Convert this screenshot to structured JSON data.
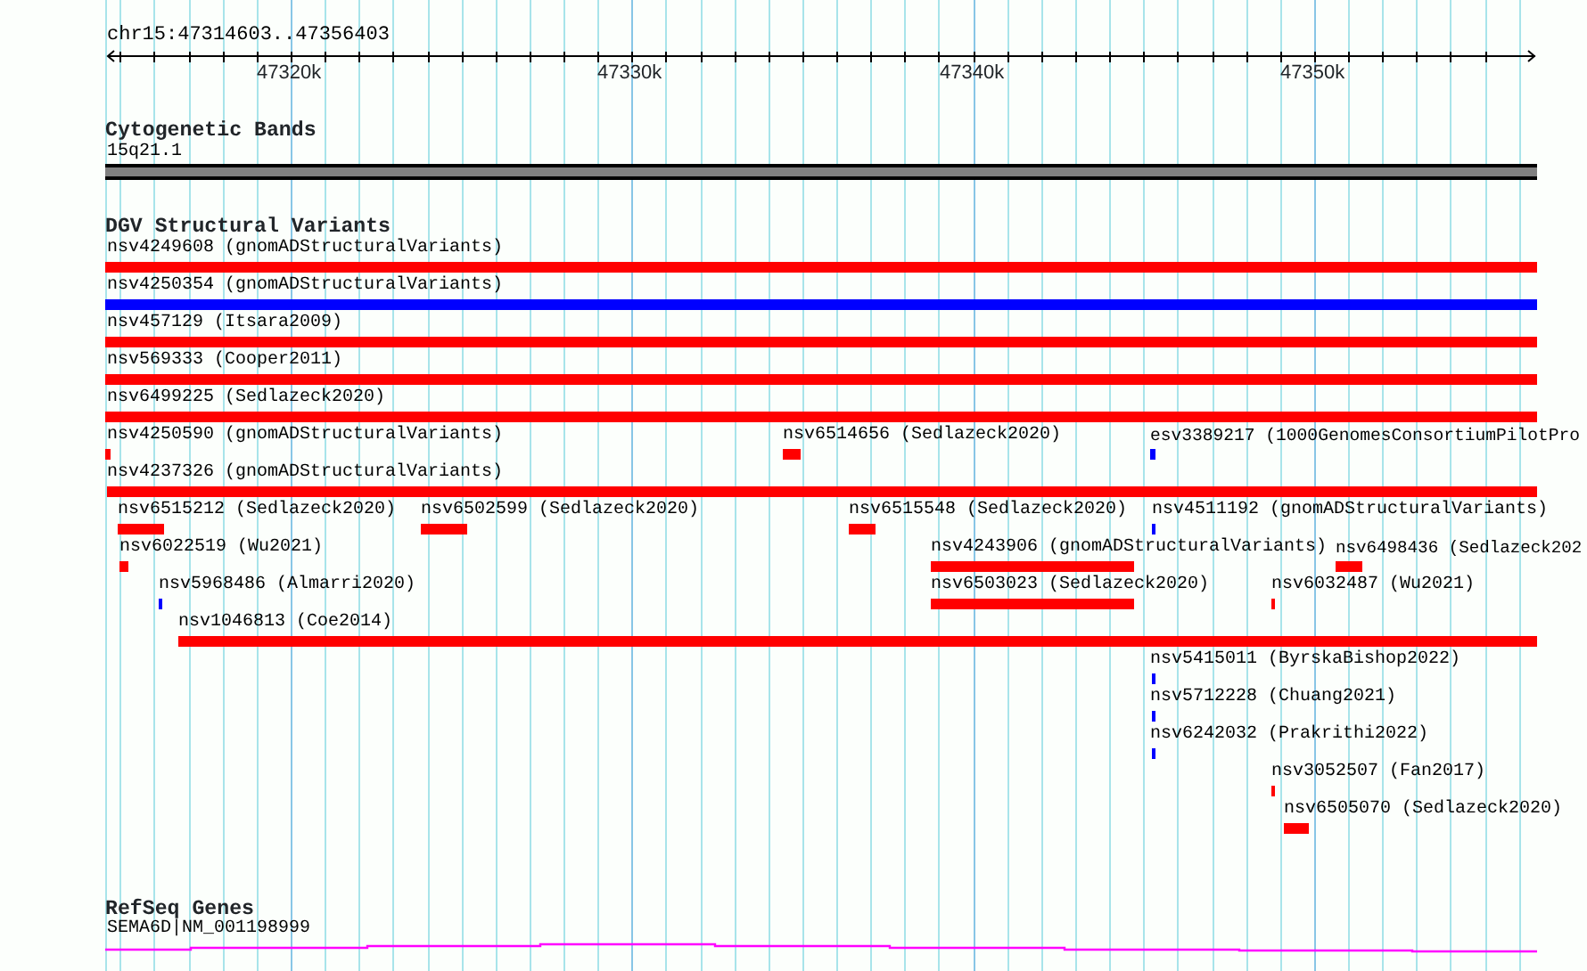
{
  "ruler": {
    "location": "chr15:47314603..47356403",
    "ticks": [
      "47320k",
      "47330k",
      "47340k",
      "47350k"
    ]
  },
  "tracks": [
    {
      "kind": "bands",
      "title": "Cytogenetic Bands",
      "features": [
        {
          "label": "15q21.1"
        }
      ]
    },
    {
      "kind": "variants",
      "title": "DGV Structural Variants",
      "features": [
        {
          "label": "nsv4249608 (gnomADStructuralVariants)",
          "color": "#ff0000"
        },
        {
          "label": "nsv4250354 (gnomADStructuralVariants)",
          "color": "#0000ff"
        },
        {
          "label": "nsv457129 (Itsara2009)",
          "color": "#ff0000"
        },
        {
          "label": "nsv569333 (Cooper2011)",
          "color": "#ff0000"
        },
        {
          "label": "nsv6499225 (Sedlazeck2020)",
          "color": "#ff0000"
        },
        {
          "label": "nsv4250590 (gnomADStructuralVariants)",
          "color": "#ff0000"
        },
        {
          "label": "nsv6514656 (Sedlazeck2020)",
          "color": "#ff0000"
        },
        {
          "label": "esv3389217 (1000GenomesConsortiumPilotPro",
          "color": "#0000ff"
        },
        {
          "label": "nsv4237326 (gnomADStructuralVariants)",
          "color": "#ff0000"
        },
        {
          "label": "nsv6515212 (Sedlazeck2020)",
          "color": "#ff0000"
        },
        {
          "label": "nsv6502599 (Sedlazeck2020)",
          "color": "#ff0000"
        },
        {
          "label": "nsv6515548 (Sedlazeck2020)",
          "color": "#ff0000"
        },
        {
          "label": "nsv4511192 (gnomADStructuralVariants)",
          "color": "#0000ff"
        },
        {
          "label": "nsv6022519 (Wu2021)",
          "color": "#ff0000"
        },
        {
          "label": "nsv4243906 (gnomADStructuralVariants)",
          "color": "#ff0000"
        },
        {
          "label": "nsv6498436 (Sedlazeck202",
          "color": "#ff0000"
        },
        {
          "label": "nsv5968486 (Almarri2020)",
          "color": "#0000ff"
        },
        {
          "label": "nsv6503023 (Sedlazeck2020)",
          "color": "#ff0000"
        },
        {
          "label": "nsv6032487 (Wu2021)",
          "color": "#ff0000"
        },
        {
          "label": "nsv1046813 (Coe2014)",
          "color": "#ff0000"
        },
        {
          "label": "nsv5415011 (ByrskaBishop2022)",
          "color": "#0000ff"
        },
        {
          "label": "nsv5712228 (Chuang2021)",
          "color": "#0000ff"
        },
        {
          "label": "nsv6242032 (Prakrithi2022)",
          "color": "#0000ff"
        },
        {
          "label": "nsv3052507 (Fan2017)",
          "color": "#ff0000"
        },
        {
          "label": "nsv6505070 (Sedlazeck2020)",
          "color": "#ff0000"
        }
      ]
    },
    {
      "kind": "genes",
      "title": "RefSeq Genes",
      "features": [
        {
          "label": "SEMA6D|NM_001198999"
        }
      ]
    }
  ]
}
